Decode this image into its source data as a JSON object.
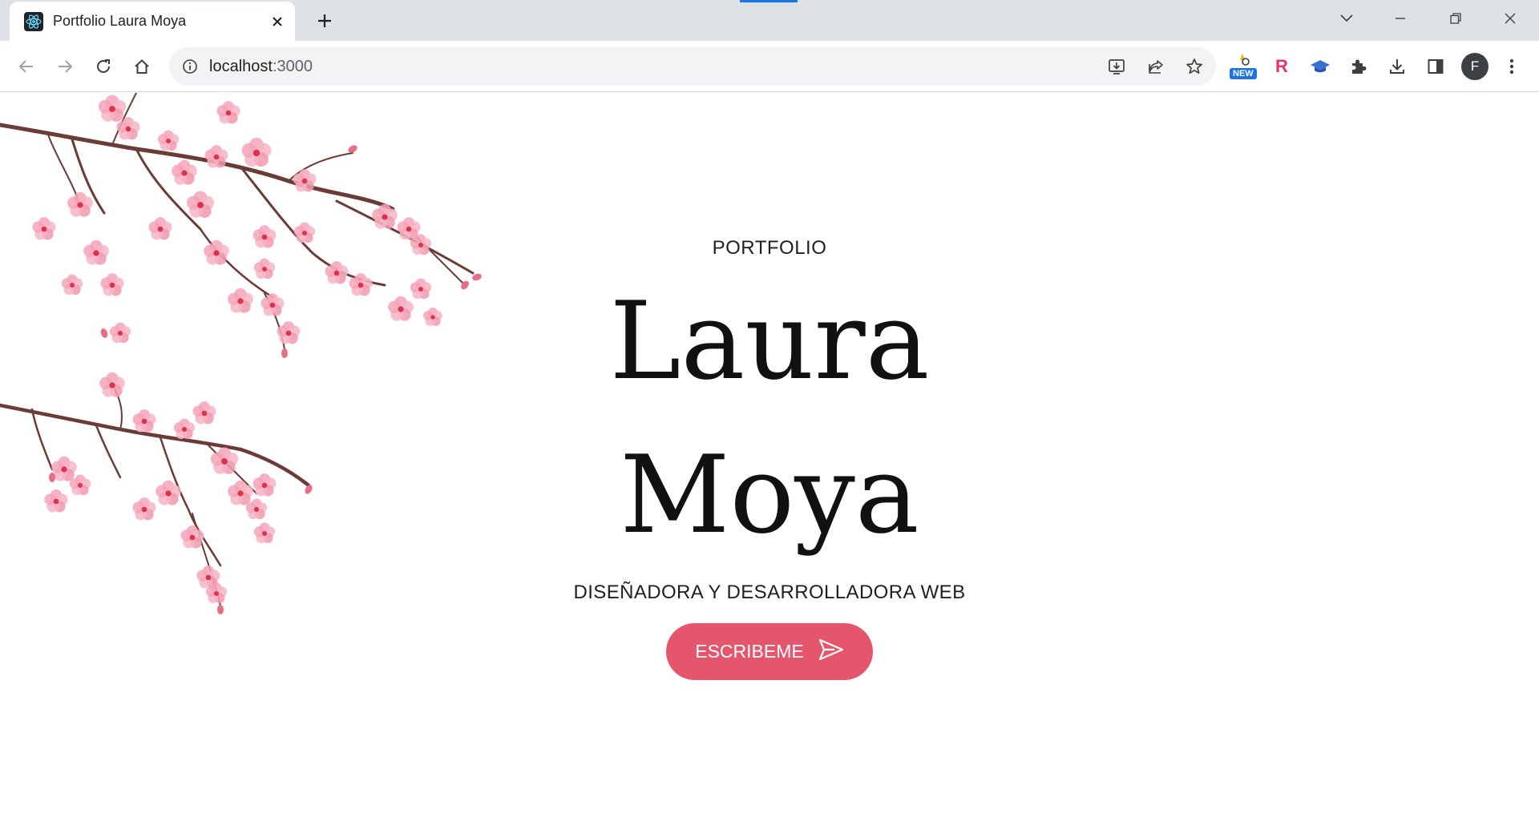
{
  "browser": {
    "tab_title": "Portfolio Laura Moya",
    "url_host": "localhost",
    "url_port": ":3000",
    "new_badge": "NEW",
    "ext_r_label": "R",
    "profile_initial": "F",
    "accent": "#1a73e8"
  },
  "hero": {
    "eyebrow": "PORTFOLIO",
    "first_name": "Laura",
    "last_name": "Moya",
    "subtitle": "DISEÑADORA Y DESARROLLADORA WEB",
    "cta_label": "ESCRIBEME",
    "cta_color": "#e5566c"
  }
}
